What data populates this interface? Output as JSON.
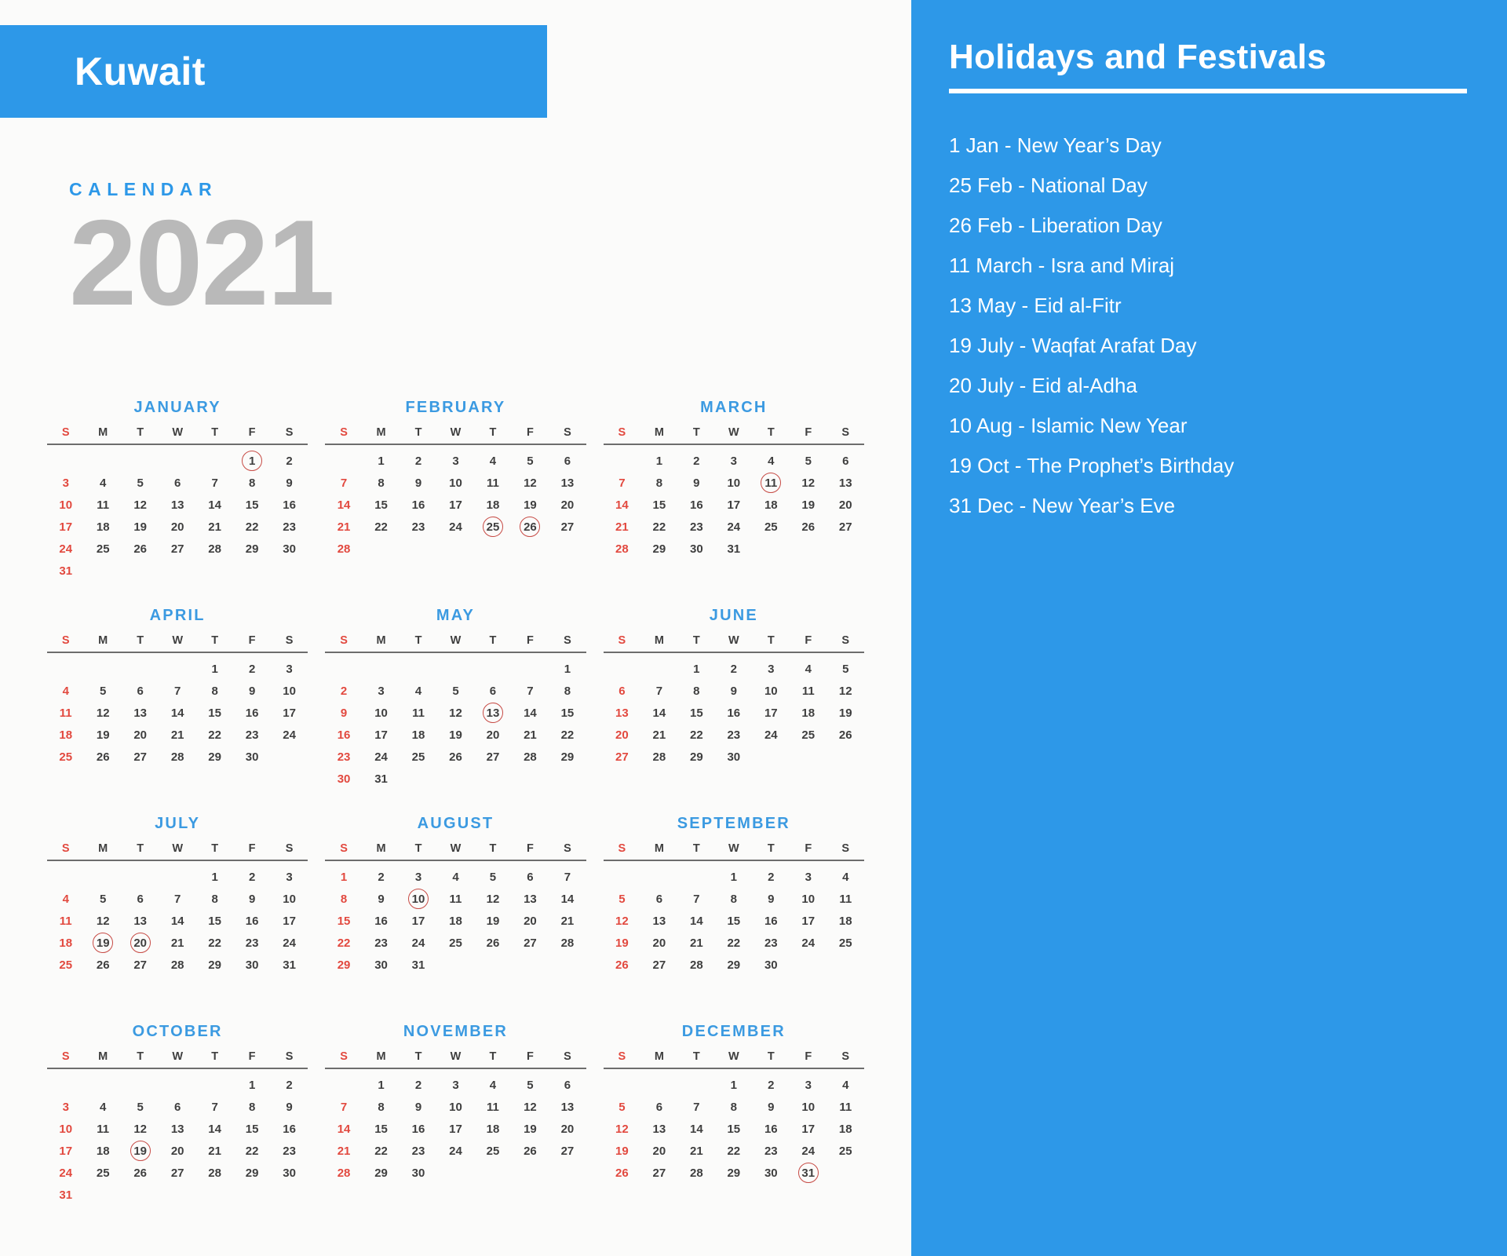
{
  "colors": {
    "accent_blue": "#2d98e8",
    "month_heading_blue": "#3b9ae1",
    "year_gray": "#b9b9b9",
    "sunday_red": "#e2493f",
    "marker_red": "#c74b45",
    "page_background": "#fbfbfa",
    "day_text": "#3f3f3f",
    "panel_text": "#ffffff"
  },
  "banner": {
    "country": "Kuwait"
  },
  "title": {
    "kicker": "CALENDAR",
    "year": "2021"
  },
  "weekday_labels": [
    "S",
    "M",
    "T",
    "W",
    "T",
    "F",
    "S"
  ],
  "calendar": {
    "year": 2021,
    "week_start": "Sunday",
    "months": [
      {
        "name": "JANUARY",
        "lead_blanks": 5,
        "days": 31,
        "marked": [
          1
        ]
      },
      {
        "name": "FEBRUARY",
        "lead_blanks": 1,
        "days": 28,
        "marked": [
          25,
          26
        ]
      },
      {
        "name": "MARCH",
        "lead_blanks": 1,
        "days": 31,
        "marked": [
          11
        ]
      },
      {
        "name": "APRIL",
        "lead_blanks": 4,
        "days": 30,
        "marked": []
      },
      {
        "name": "MAY",
        "lead_blanks": 6,
        "days": 31,
        "marked": [
          13
        ]
      },
      {
        "name": "JUNE",
        "lead_blanks": 2,
        "days": 30,
        "marked": []
      },
      {
        "name": "JULY",
        "lead_blanks": 4,
        "days": 31,
        "marked": [
          19,
          20
        ]
      },
      {
        "name": "AUGUST",
        "lead_blanks": 0,
        "days": 31,
        "marked": [
          10
        ]
      },
      {
        "name": "SEPTEMBER",
        "lead_blanks": 3,
        "days": 30,
        "marked": []
      },
      {
        "name": "OCTOBER",
        "lead_blanks": 5,
        "days": 31,
        "marked": [
          19
        ]
      },
      {
        "name": "NOVEMBER",
        "lead_blanks": 1,
        "days": 30,
        "marked": []
      },
      {
        "name": "DECEMBER",
        "lead_blanks": 3,
        "days": 31,
        "marked": [
          31
        ]
      }
    ]
  },
  "holidays_panel": {
    "title": "Holidays and Festivals",
    "items": [
      "1 Jan - New Year’s Day",
      "25 Feb - National Day",
      "26 Feb - Liberation Day",
      "11 March - Isra and Miraj",
      "13 May - Eid al-Fitr",
      "19 July - Waqfat Arafat Day",
      "20 July - Eid al-Adha",
      "10 Aug - Islamic New Year",
      "19 Oct - The Prophet’s Birthday",
      "31 Dec - New Year’s Eve"
    ]
  }
}
